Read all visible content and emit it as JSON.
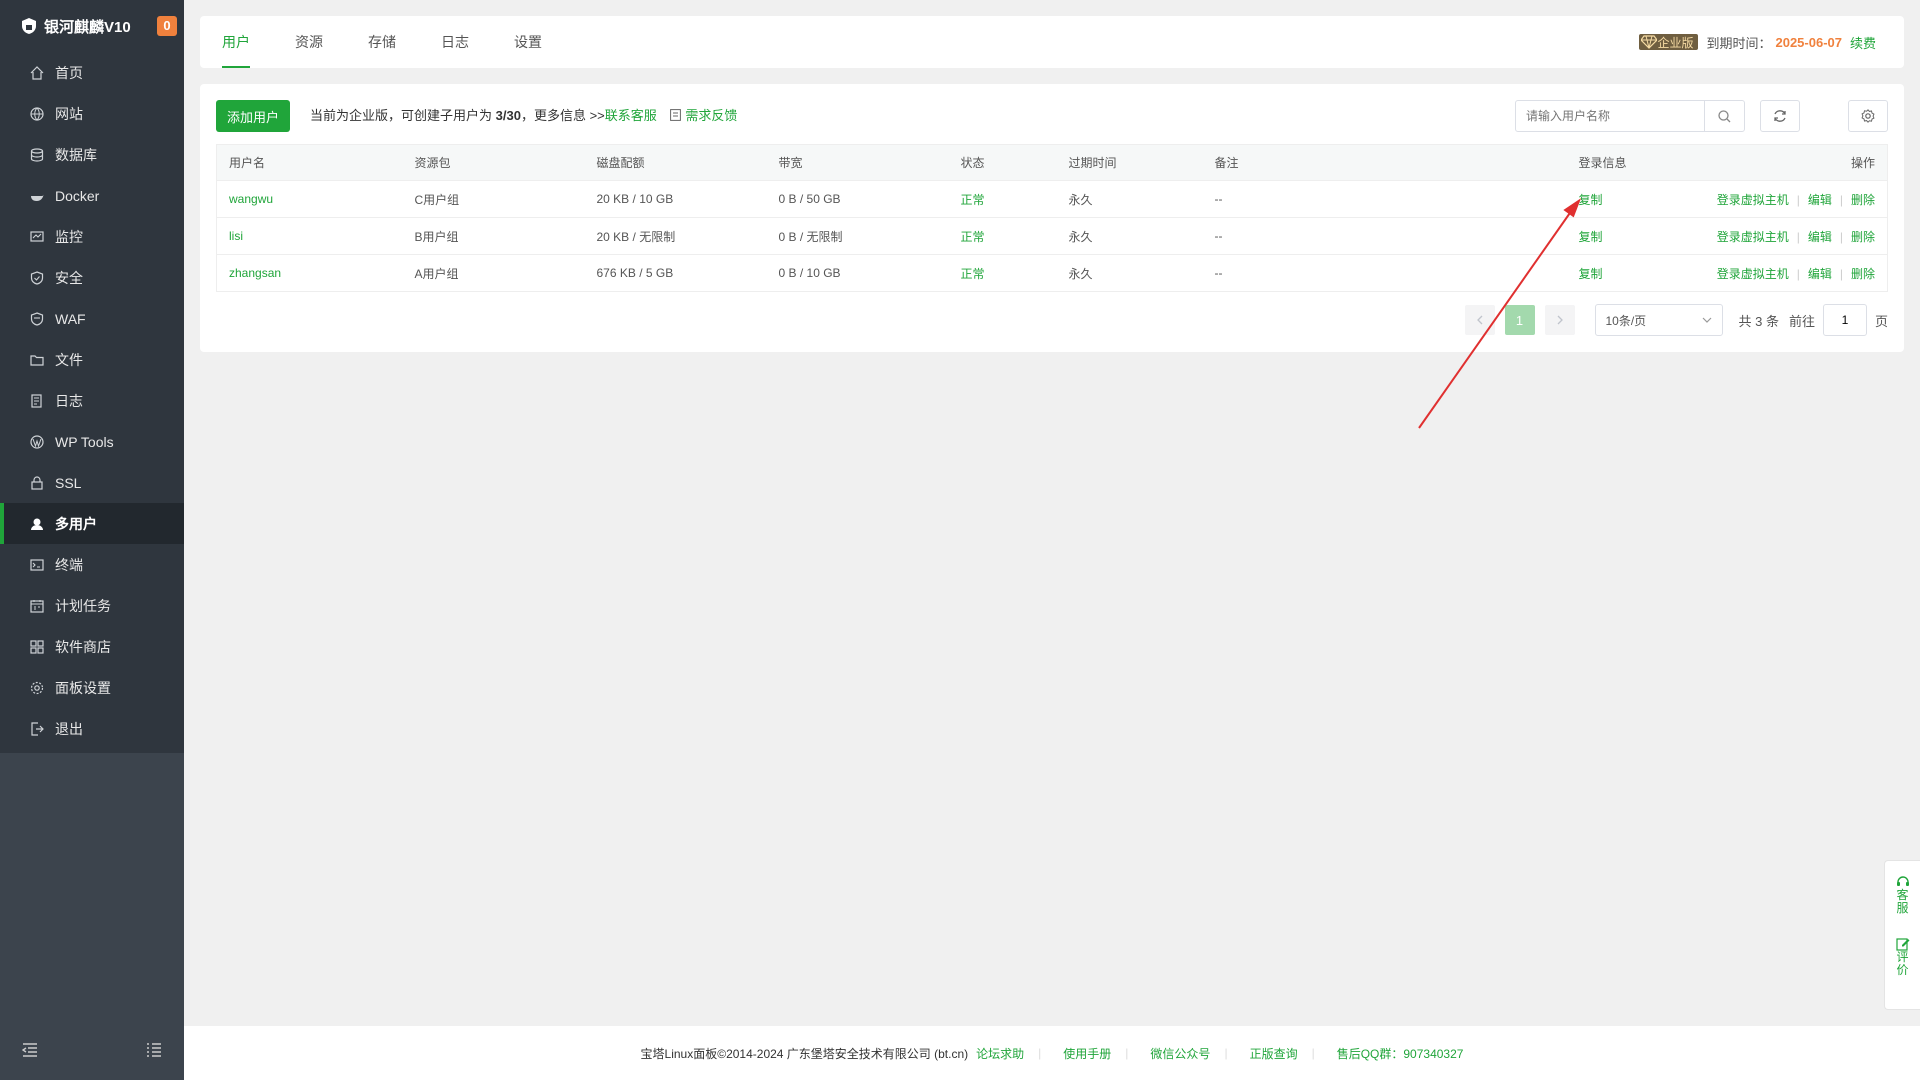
{
  "app": {
    "brand": "银河麒麟V10",
    "badge": "0"
  },
  "sidebar": {
    "items": [
      {
        "label": "首页",
        "icon": "home-icon"
      },
      {
        "label": "网站",
        "icon": "globe-icon"
      },
      {
        "label": "数据库",
        "icon": "database-icon"
      },
      {
        "label": "Docker",
        "icon": "docker-icon"
      },
      {
        "label": "监控",
        "icon": "monitor-icon"
      },
      {
        "label": "安全",
        "icon": "shield-icon"
      },
      {
        "label": "WAF",
        "icon": "waf-shield-icon"
      },
      {
        "label": "文件",
        "icon": "folder-icon"
      },
      {
        "label": "日志",
        "icon": "log-icon"
      },
      {
        "label": "WP Tools",
        "icon": "wordpress-icon"
      },
      {
        "label": "SSL",
        "icon": "ssl-icon"
      },
      {
        "label": "多用户",
        "icon": "users-icon"
      },
      {
        "label": "终端",
        "icon": "terminal-icon"
      },
      {
        "label": "计划任务",
        "icon": "calendar-icon"
      },
      {
        "label": "软件商店",
        "icon": "apps-icon"
      },
      {
        "label": "面板设置",
        "icon": "gear-icon"
      },
      {
        "label": "退出",
        "icon": "logout-icon"
      }
    ],
    "active_index": 11
  },
  "tabs": [
    "用户",
    "资源",
    "存储",
    "日志",
    "设置"
  ],
  "expire": {
    "badge": "企业版",
    "label": "到期时间：",
    "date": "2025-06-07",
    "renew": "续费"
  },
  "toolbar": {
    "add_label": "添加用户",
    "notice_prefix": "当前为企业版，可创建子用户为",
    "notice_count": "3/30",
    "notice_suffix": "，更多信息 >>",
    "contact": "联系客服",
    "feedback": "需求反馈",
    "search_placeholder": "请输入用户名称"
  },
  "table": {
    "headers": [
      "用户名",
      "资源包",
      "磁盘配额",
      "带宽",
      "状态",
      "过期时间",
      "备注",
      "登录信息",
      "操作"
    ],
    "rows": [
      {
        "username": "wangwu",
        "package": "C用户组",
        "disk": "20 KB / 10 GB",
        "bandwidth": "0 B / 50 GB",
        "status": "正常",
        "expire": "永久",
        "remark": "--",
        "login": "复制"
      },
      {
        "username": "lisi",
        "package": "B用户组",
        "disk": "20 KB / 无限制",
        "bandwidth": "0 B / 无限制",
        "status": "正常",
        "expire": "永久",
        "remark": "--",
        "login": "复制"
      },
      {
        "username": "zhangsan",
        "package": "A用户组",
        "disk": "676 KB / 5 GB",
        "bandwidth": "0 B / 10 GB",
        "status": "正常",
        "expire": "永久",
        "remark": "--",
        "login": "复制"
      }
    ],
    "ops": [
      "登录虚拟主机",
      "编辑",
      "删除"
    ]
  },
  "pager": {
    "current": "1",
    "size": "10条/页",
    "total": "共 3 条",
    "goto": "前往",
    "goto_value": "1",
    "page_unit": "页"
  },
  "footer": {
    "copyright": "宝塔Linux面板©2014-2024 广东堡塔安全技术有限公司 (bt.cn)",
    "links": [
      "论坛求助",
      "使用手册",
      "微信公众号",
      "正版查询",
      "售后QQ群：907340327"
    ]
  },
  "float": {
    "service": "客服",
    "review": "评价"
  },
  "colors": {
    "accent": "#20a53a",
    "orange": "#f0813d",
    "sidebar": "#3c444d",
    "annotation_arrow": "#e03030"
  }
}
